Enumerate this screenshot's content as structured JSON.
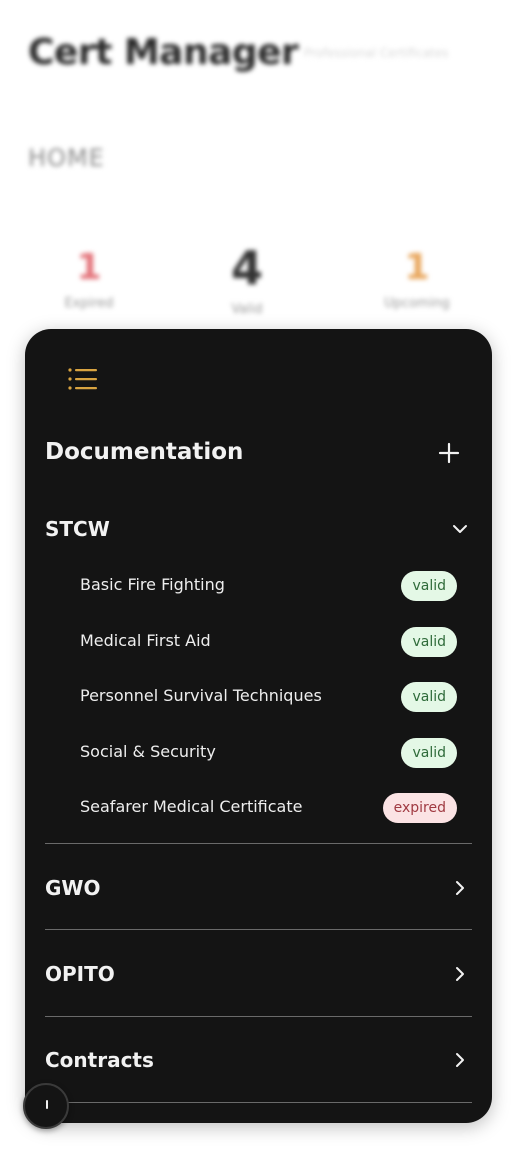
{
  "background": {
    "app_title": "Cert Manager",
    "app_subtitle": "Professional Certificates",
    "section": "HOME",
    "stats": [
      {
        "value": "1",
        "label": "Expired",
        "color": "#e3737a"
      },
      {
        "value": "4",
        "label": "Valid",
        "color": "#333333"
      },
      {
        "value": "1",
        "label": "Upcoming",
        "color": "#e8a65c"
      }
    ]
  },
  "panel": {
    "menu_icon": "list-icon",
    "menu_icon_color": "#d9a441",
    "title": "Documentation",
    "add_icon": "plus-icon",
    "groups": [
      {
        "label": "STCW",
        "expanded": true,
        "chevron": "chevron-down-icon",
        "items": [
          {
            "name": "Basic Fire Fighting",
            "status": "valid"
          },
          {
            "name": "Medical First Aid",
            "status": "valid"
          },
          {
            "name": "Personnel Survival Techniques",
            "status": "valid"
          },
          {
            "name": "Social & Security",
            "status": "valid"
          },
          {
            "name": "Seafarer Medical Certificate",
            "status": "expired"
          }
        ]
      },
      {
        "label": "GWO",
        "expanded": false,
        "chevron": "chevron-right-icon"
      },
      {
        "label": "OPITO",
        "expanded": false,
        "chevron": "chevron-right-icon"
      },
      {
        "label": "Contracts",
        "expanded": false,
        "chevron": "chevron-right-icon"
      }
    ]
  },
  "colors": {
    "panel_bg": "#141414",
    "valid_bg": "#e4f8e6",
    "expired_bg": "#fbe3e4"
  }
}
